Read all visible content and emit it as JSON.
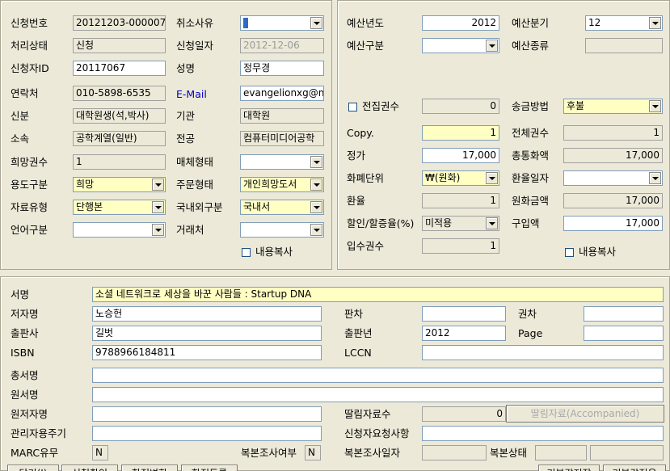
{
  "left": {
    "app_no_label": "신청번호",
    "app_no": "20121203-000007",
    "cancel_reason_label": "취소사유",
    "status_label": "처리상태",
    "status": "신청",
    "apply_date_label": "신청일자",
    "apply_date": "2012-12-06",
    "applicant_id_label": "신청자ID",
    "applicant_id": "20117067",
    "name_label": "성명",
    "name": "정무경",
    "contact_label": "연락처",
    "contact": "010-5898-6535",
    "email_label": "E-Mail",
    "email": "evangelionxg@na",
    "identity_label": "신분",
    "identity": "대학원생(석,박사)",
    "org_label": "기관",
    "org": "대학원",
    "affil_label": "소속",
    "affil": "공학계열(일반)",
    "major_label": "전공",
    "major": "컴퓨터미디어공학",
    "wish_copies_label": "희망권수",
    "wish_copies": "1",
    "media_type_label": "매체형태",
    "usage_label": "용도구분",
    "usage": "희망",
    "order_type_label": "주문형태",
    "order_type": "개인희망도서",
    "material_type_label": "자료유형",
    "material_type": "단행본",
    "domestic_label": "국내외구분",
    "domestic": "국내서",
    "lang_label": "언어구분",
    "vendor_label": "거래처",
    "copy_content_label": "내용복사"
  },
  "right": {
    "budget_year_label": "예산년도",
    "budget_year": "2012",
    "budget_quarter_label": "예산분기",
    "budget_quarter": "12",
    "budget_div_label": "예산구분",
    "budget_kind_label": "예산종류",
    "full_set_label": "전집권수",
    "full_set": "0",
    "remit_label": "송금방법",
    "remit": "후불",
    "copy_label": "Copy.",
    "copy": "1",
    "total_copies_label": "전체권수",
    "total_copies": "1",
    "price_label": "정가",
    "price": "17,000",
    "total_foreign_label": "총통화액",
    "total_foreign": "17,000",
    "currency_label": "화폐단위",
    "currency": "₩(원화)",
    "rate_date_label": "환율일자",
    "rate_label": "환율",
    "rate": "1",
    "krw_amount_label": "원화금액",
    "krw_amount": "17,000",
    "discount_label": "할인/할증율(%)",
    "discount": "미적용",
    "purchase_label": "구입액",
    "purchase": "17,000",
    "received_label": "입수권수",
    "received": "1",
    "copy_content_label": "내용복사"
  },
  "bottom": {
    "title_label": "서명",
    "title": "소셜 네트워크로 세상을 바꾼 사람들 : Startup DNA",
    "author_label": "저자명",
    "author": "노승헌",
    "edition_label": "판차",
    "volume_label": "권차",
    "publisher_label": "출판사",
    "publisher": "길벗",
    "pub_year_label": "출판년",
    "pub_year": "2012",
    "page_label": "Page",
    "isbn_label": "ISBN",
    "isbn": "9788966184811",
    "lccn_label": "LCCN",
    "series_label": "총서명",
    "orig_title_label": "원서명",
    "orig_author_label": "원저자명",
    "accomp_count_label": "딸림자료수",
    "accomp_count": "0",
    "accomp_button": "딸림자료(Accompanied)",
    "admin_note_label": "관리자용주기",
    "applicant_note_label": "신청자요청사항",
    "marc_label": "MARC유무",
    "marc": "N",
    "dup_check_label": "복본조사여부",
    "dup_check": "N",
    "dup_date_label": "복본조사일자",
    "dup_status_label": "복본상태"
  },
  "buttons": [
    "닫기(I)",
    "신청확인",
    "항적변화",
    "항적등록",
    "기본값저장",
    "기본값적용"
  ]
}
